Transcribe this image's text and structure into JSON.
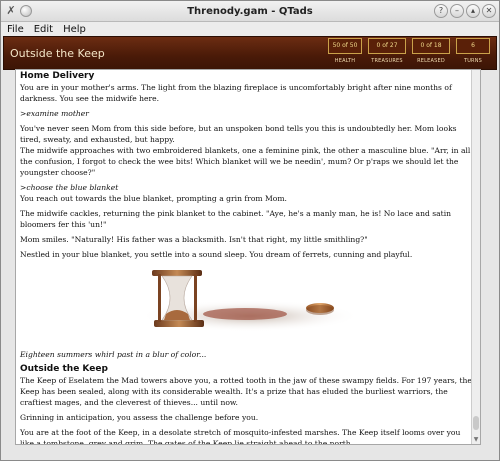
{
  "window": {
    "title": "Threnody.gam - QTads"
  },
  "menu": {
    "items": [
      "File",
      "Edit",
      "Help"
    ]
  },
  "banner": {
    "location": "Outside the Keep",
    "stats": [
      {
        "value": "50 of 50",
        "label": "HEALTH"
      },
      {
        "value": "0 of 27",
        "label": "TREASURES"
      },
      {
        "value": "0 of 18",
        "label": "RELEASED"
      },
      {
        "value": "6",
        "label": "TURNS"
      }
    ]
  },
  "story": {
    "section1_title": "Home Delivery",
    "p1": "You are in your mother's arms. The light from the blazing fireplace is uncomfortably bright after nine months of darkness. You see the midwife here.",
    "cmd1": ">examine mother",
    "p2": "You've never seen Mom from this side before, but an unspoken bond tells you this is undoubtedly her. Mom looks tired, sweaty, and exhausted, but happy.",
    "p3": "The midwife approaches with two embroidered blankets, one a feminine pink, the other a masculine blue. \"Arr, in all the confusion, I forgot to check the wee bits! Which blanket will we be needin', mum? Or p'raps we should let the youngster choose?\"",
    "cmd2": ">choose the blue blanket",
    "p4": "You reach out towards the blue blanket, prompting a grin from Mom.",
    "p5": "The midwife cackles, returning the pink blanket to the cabinet. \"Aye, he's a manly man, he is! No lace and satin bloomers fer this 'un!\"",
    "p6": "Mom smiles. \"Naturally! His father was a blacksmith. Isn't that right, my little smithling?\"",
    "p7": "Nestled in your blue blanket, you settle into a sound sleep. You dream of ferrets, cunning and playful.",
    "caption": "Eighteen summers whirl past in a blur of color...",
    "section2_title": "Outside the Keep",
    "p8": "The Keep of Eselatem the Mad towers above you, a rotted tooth in the jaw of these swampy fields. For 197 years, the Keep has been sealed, along with its considerable wealth. It's a prize that has eluded the burliest warriors, the craftiest mages, and the cleverest of thieves... until now.",
    "p9": "Grinning in anticipation, you assess the challenge before you.",
    "p10": "You are at the foot of the Keep, in a desolate stretch of mosquito-infested marshes. The Keep itself looms over you like a tombstone, grey and grim. The gates of the Keep lie straight ahead to the north.",
    "prompt": ">"
  },
  "icons": {
    "app": "qtads-app-icon",
    "illustration": "hourglass-coin-illustration"
  }
}
